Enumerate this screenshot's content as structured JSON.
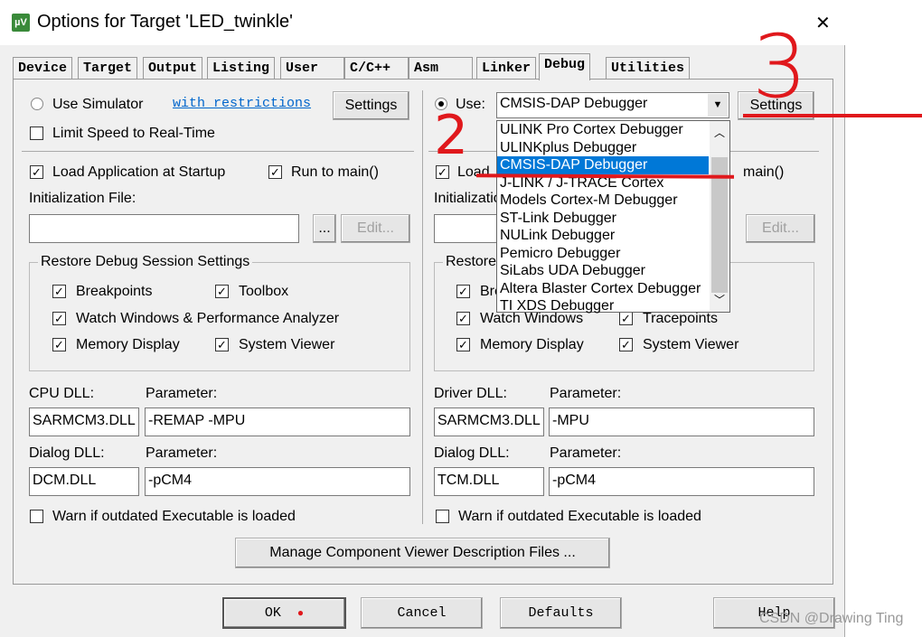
{
  "window": {
    "title": "Options for Target 'LED_twinkle'",
    "close": "✕"
  },
  "tabs": [
    {
      "label": "Device"
    },
    {
      "label": "Target"
    },
    {
      "label": "Output"
    },
    {
      "label": "Listing"
    },
    {
      "label": "User"
    },
    {
      "label": "C/C++"
    },
    {
      "label": "Asm"
    },
    {
      "label": "Linker"
    },
    {
      "label": "Debug",
      "active": true
    },
    {
      "label": "Utilities"
    }
  ],
  "left": {
    "use_simulator": "Use Simulator",
    "restrictions_link": "with restrictions",
    "settings": "Settings",
    "limit_speed": "Limit Speed to Real-Time",
    "load_app": "Load Application at Startup",
    "run_main": "Run to main()",
    "init_file": "Initialization File:",
    "init_value": "",
    "browse": "...",
    "edit": "Edit...",
    "restore_title": "Restore Debug Session Settings",
    "breakpoints": "Breakpoints",
    "toolbox": "Toolbox",
    "watch": "Watch Windows & Performance Analyzer",
    "memory": "Memory Display",
    "sysviewer": "System Viewer",
    "cpu_dll": "CPU DLL:",
    "parameter": "Parameter:",
    "cpu_dll_value": "SARMCM3.DLL",
    "cpu_param_value": "-REMAP -MPU",
    "dialog_dll": "Dialog DLL:",
    "dialog_dll_value": "DCM.DLL",
    "dialog_param_value": "-pCM4",
    "warn": "Warn if outdated Executable is loaded"
  },
  "right": {
    "use": "Use:",
    "selected_debugger": "CMSIS-DAP Debugger",
    "settings": "Settings",
    "load_app": "Load",
    "run_main": "main()",
    "init_file": "Initializatio",
    "edit": "Edit...",
    "restore_title": "Restore",
    "breakpoints": "Bre",
    "watch": "Watch Windows",
    "tracepoints": "Tracepoints",
    "memory": "Memory Display",
    "sysviewer": "System Viewer",
    "driver_dll": "Driver DLL:",
    "parameter": "Parameter:",
    "driver_dll_value": "SARMCM3.DLL",
    "driver_param_value": "-MPU",
    "dialog_dll": "Dialog DLL:",
    "dialog_dll_value": "TCM.DLL",
    "dialog_param_value": "-pCM4",
    "warn": "Warn if outdated Executable is loaded"
  },
  "dropdown_options": [
    "ULINK Pro Cortex Debugger",
    "ULINKplus Debugger",
    "CMSIS-DAP Debugger",
    "J-LINK / J-TRACE Cortex",
    "Models Cortex-M Debugger",
    "ST-Link Debugger",
    "NULink Debugger",
    "Pemicro Debugger",
    "SiLabs UDA Debugger",
    "Altera Blaster Cortex Debugger",
    "TI XDS Debugger"
  ],
  "manage_button": "Manage Component Viewer Description Files ...",
  "footer": {
    "ok": "OK",
    "cancel": "Cancel",
    "defaults": "Defaults",
    "help": "Help"
  },
  "annotations": {
    "step2": "2",
    "step3": "3"
  },
  "watermark": "CSDN @Drawing Ting",
  "colors": {
    "selection": "#0078d7",
    "annotation": "#e0181c",
    "link": "#0066cc"
  }
}
